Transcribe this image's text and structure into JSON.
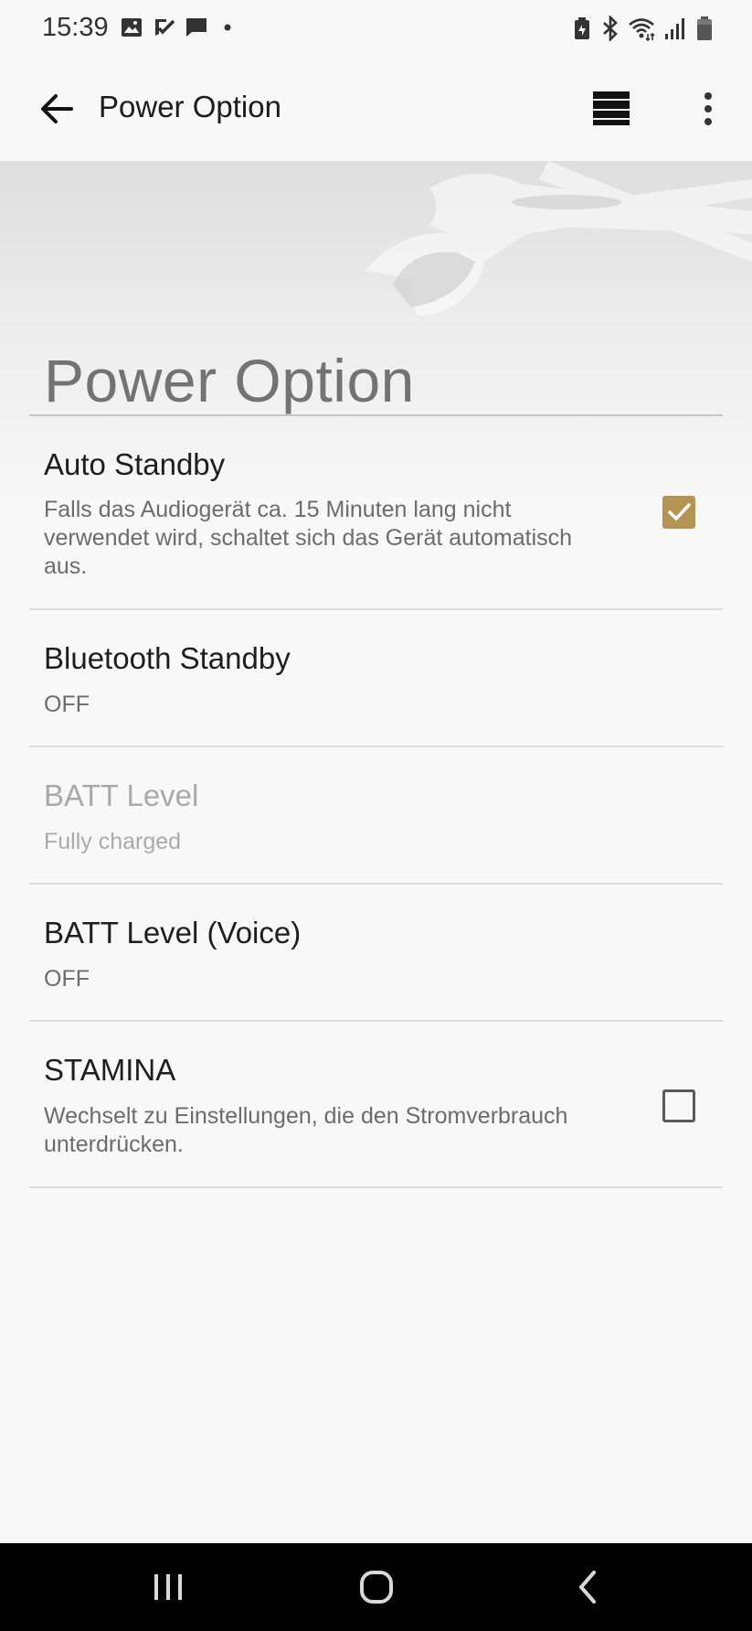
{
  "status_bar": {
    "time": "15:39",
    "left_icons": [
      "gallery-icon",
      "task-check-icon",
      "message-icon",
      "dot-icon"
    ],
    "right_icons": [
      "battery-saver-icon",
      "bluetooth-icon",
      "wifi-icon",
      "signal-icon",
      "battery-icon"
    ]
  },
  "app_bar": {
    "title": "Power Option",
    "back_icon": "arrow-left-icon",
    "equalizer_icon": "equalizer-icon",
    "more_icon": "more-vert-icon"
  },
  "page": {
    "heading": "Power Option"
  },
  "preferences": [
    {
      "title": "Auto Standby",
      "summary": "Falls das Audiogerät ca. 15 Minuten lang nicht verwendet wird, schaltet sich das Gerät automatisch aus.",
      "checked": true,
      "enabled": true
    },
    {
      "title": "Bluetooth Standby",
      "summary": "OFF",
      "enabled": true
    },
    {
      "title": "BATT Level",
      "summary": "Fully charged",
      "enabled": false
    },
    {
      "title": "BATT Level (Voice)",
      "summary": "OFF",
      "enabled": true
    },
    {
      "title": "STAMINA",
      "summary": "Wechselt zu Einstellungen, die den Stromverbrauch unterdrücken.",
      "checked": false,
      "enabled": true
    }
  ],
  "colors": {
    "accent": "#b39452",
    "background": "#f8f8f8",
    "nav_bar": "#000000"
  },
  "nav_bar": {
    "icons": [
      "recents-icon",
      "home-icon",
      "back-icon"
    ]
  }
}
